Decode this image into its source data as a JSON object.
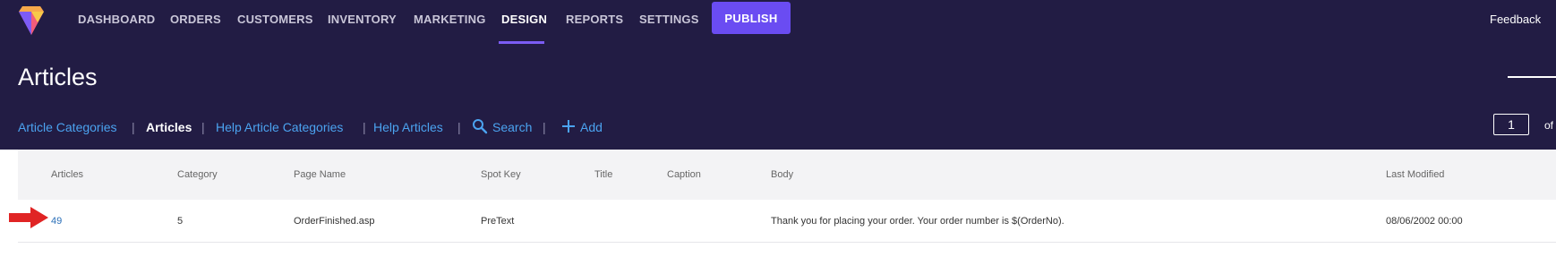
{
  "app": {
    "nav": [
      {
        "label": "DASHBOARD"
      },
      {
        "label": "ORDERS"
      },
      {
        "label": "CUSTOMERS"
      },
      {
        "label": "INVENTORY"
      },
      {
        "label": "MARKETING"
      },
      {
        "label": "DESIGN",
        "active": true
      },
      {
        "label": "REPORTS"
      },
      {
        "label": "SETTINGS"
      }
    ],
    "publish_label": "PUBLISH",
    "feedback_label": "Feedback",
    "colors": {
      "topbar": "#221c44",
      "accent": "#6a4cf2",
      "link": "#4ba3f0",
      "arrow": "#e02424"
    }
  },
  "page": {
    "title": "Articles",
    "subnav": {
      "article_categories": "Article Categories",
      "articles": "Articles",
      "help_article_categories": "Help Article Categories",
      "help_articles": "Help Articles",
      "search": "Search",
      "add": "Add",
      "separator": "|"
    },
    "pagination": {
      "current": "1",
      "of_label": "of"
    }
  },
  "table": {
    "headers": [
      "Articles",
      "Category",
      "Page Name",
      "Spot Key",
      "Title",
      "Caption",
      "Body",
      "Last Modified"
    ],
    "rows": [
      {
        "articles": "49",
        "category": "5",
        "page_name": "OrderFinished.asp",
        "spot_key": "PreText",
        "title": "",
        "caption": "",
        "body": "Thank you for placing your order. Your order number is $(OrderNo).",
        "last_modified": "08/06/2002 00:00"
      }
    ]
  }
}
